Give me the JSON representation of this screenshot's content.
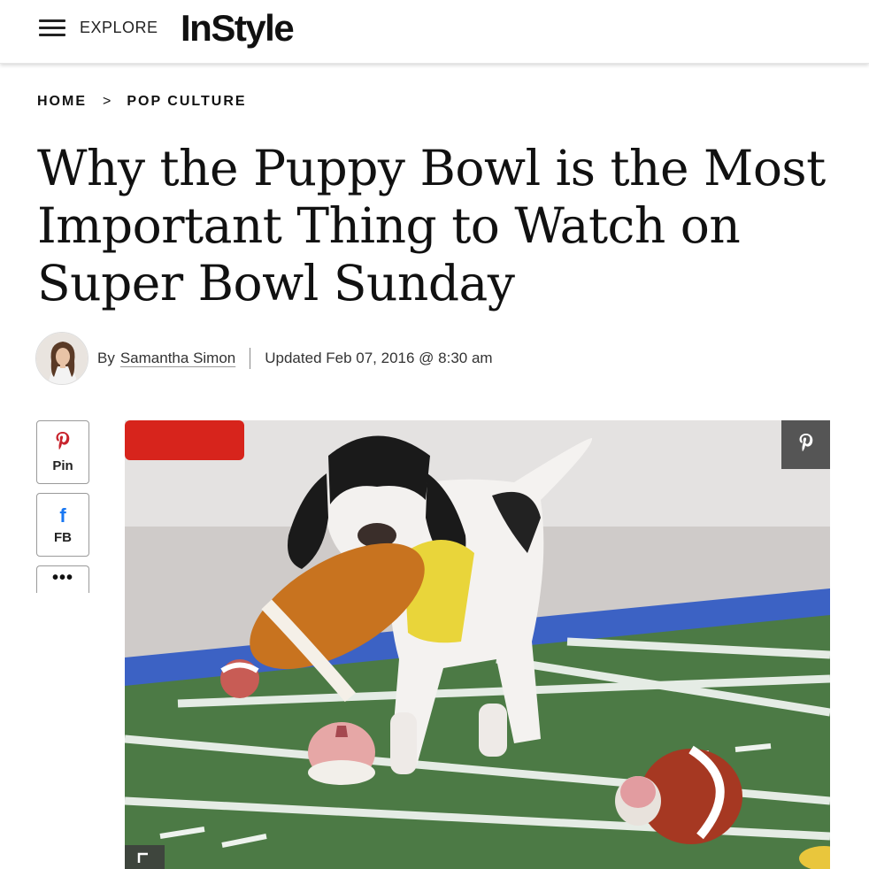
{
  "header": {
    "menu_label": "EXPLORE",
    "logo_text": "InStyle"
  },
  "breadcrumb": {
    "items": [
      "HOME",
      "POP CULTURE"
    ],
    "separator": ">"
  },
  "article": {
    "title": "Why the Puppy Bowl is the Most Important Thing to Watch on Super Bowl Sunday",
    "byline_prefix": "By",
    "author": "Samantha Simon",
    "updated": "Updated Feb 07, 2016 @ 8:30 am"
  },
  "share": {
    "pin_label": "Pin",
    "fb_label": "FB",
    "more_label": "•••"
  },
  "colors": {
    "pinterest": "#c8232c",
    "facebook": "#1877f2",
    "turf": "#4c7a45"
  },
  "icons": {
    "menu": "hamburger-icon",
    "pin": "pinterest-icon",
    "fb": "facebook-icon",
    "more": "more-icon",
    "expand": "expand-icon"
  }
}
